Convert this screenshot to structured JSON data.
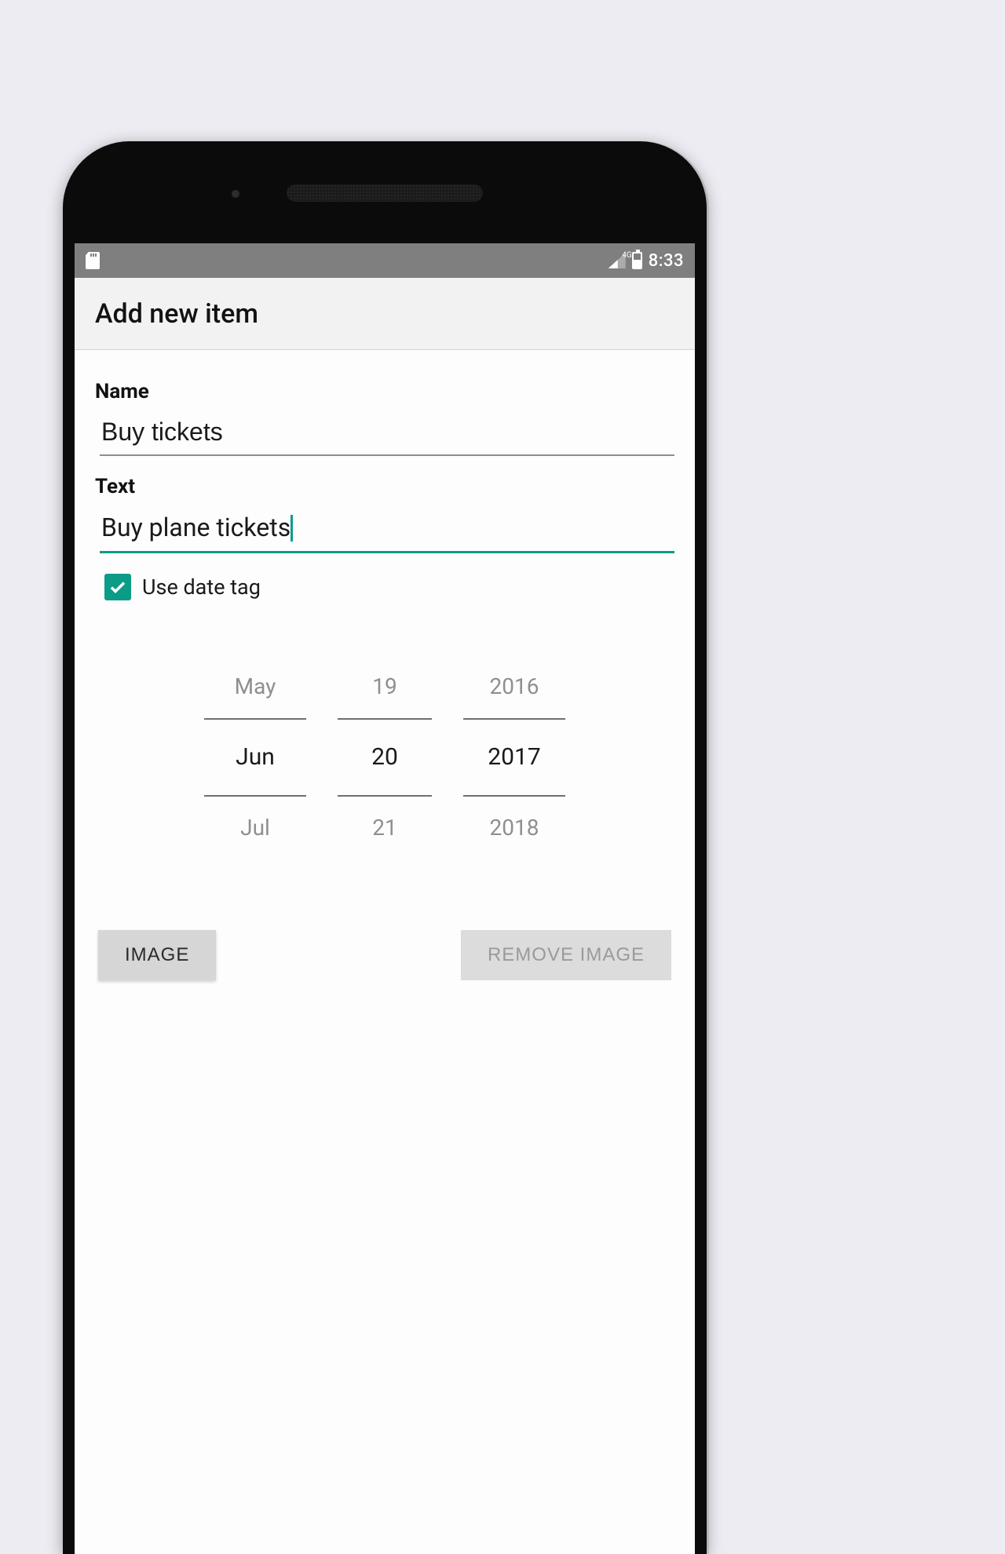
{
  "status": {
    "network_label": "4G",
    "time": "8:33"
  },
  "appbar": {
    "title": "Add new item"
  },
  "form": {
    "name_label": "Name",
    "name_value": "Buy tickets",
    "text_label": "Text",
    "text_value": "Buy plane tickets",
    "use_date_tag_label": "Use date tag",
    "use_date_tag_checked": true
  },
  "date_picker": {
    "month": {
      "prev": "May",
      "selected": "Jun",
      "next": "Jul"
    },
    "day": {
      "prev": "19",
      "selected": "20",
      "next": "21"
    },
    "year": {
      "prev": "2016",
      "selected": "2017",
      "next": "2018"
    }
  },
  "buttons": {
    "image": "IMAGE",
    "remove_image": "REMOVE IMAGE"
  },
  "colors": {
    "accent": "#0b9c88",
    "statusbar": "#7f7f7f",
    "appbar_bg": "#f2f2f2"
  }
}
